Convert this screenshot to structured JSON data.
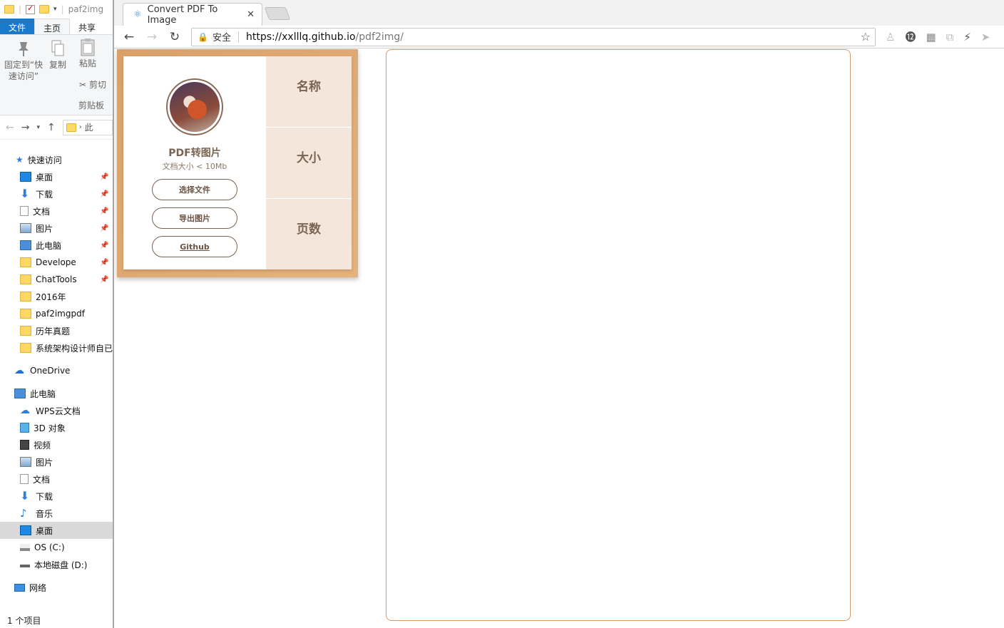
{
  "explorer": {
    "title_fragment": "paf2img",
    "ribbon_tabs": [
      "文件",
      "主页",
      "共享"
    ],
    "ribbon": {
      "pin_label": "固定到“快速访问”",
      "copy_label": "复制",
      "paste_label": "粘贴",
      "cut_label": "剪切",
      "group_label": "剪贴板"
    },
    "nav_address": "此",
    "tree": {
      "quick_access": "快速访问",
      "quick_items": [
        "桌面",
        "下载",
        "文档",
        "图片",
        "此电脑",
        "Develope",
        "ChatTools",
        "2016年",
        "paf2imgpdf",
        "历年真题",
        "系统架构设计师自已"
      ],
      "onedrive": "OneDrive",
      "this_pc": "此电脑",
      "pc_items": [
        "WPS云文档",
        "3D 对象",
        "视频",
        "图片",
        "文档",
        "下载",
        "音乐",
        "桌面",
        "OS (C:)",
        "本地磁盘 (D:)"
      ],
      "network": "网络"
    },
    "status": "1 个项目"
  },
  "browser": {
    "tab_title": "Convert PDF To Image",
    "secure_label": "安全",
    "url_host": "https://xxlllq.github.io",
    "url_path": "/pdf2img/"
  },
  "app": {
    "title": "PDF转图片",
    "subtitle": "文档大小 < 10Mb",
    "buttons": {
      "choose": "选择文件",
      "export": "导出图片",
      "github": "Github"
    },
    "stats": {
      "name": "名称",
      "size": "大小",
      "pages": "页数"
    }
  },
  "colors": {
    "accent_brown": "#7a6452",
    "card_frame": "#d9a06a",
    "stat_bg": "#f5e6dc",
    "preview_border": "#d39a6e",
    "explorer_file_tab": "#1979ca"
  }
}
